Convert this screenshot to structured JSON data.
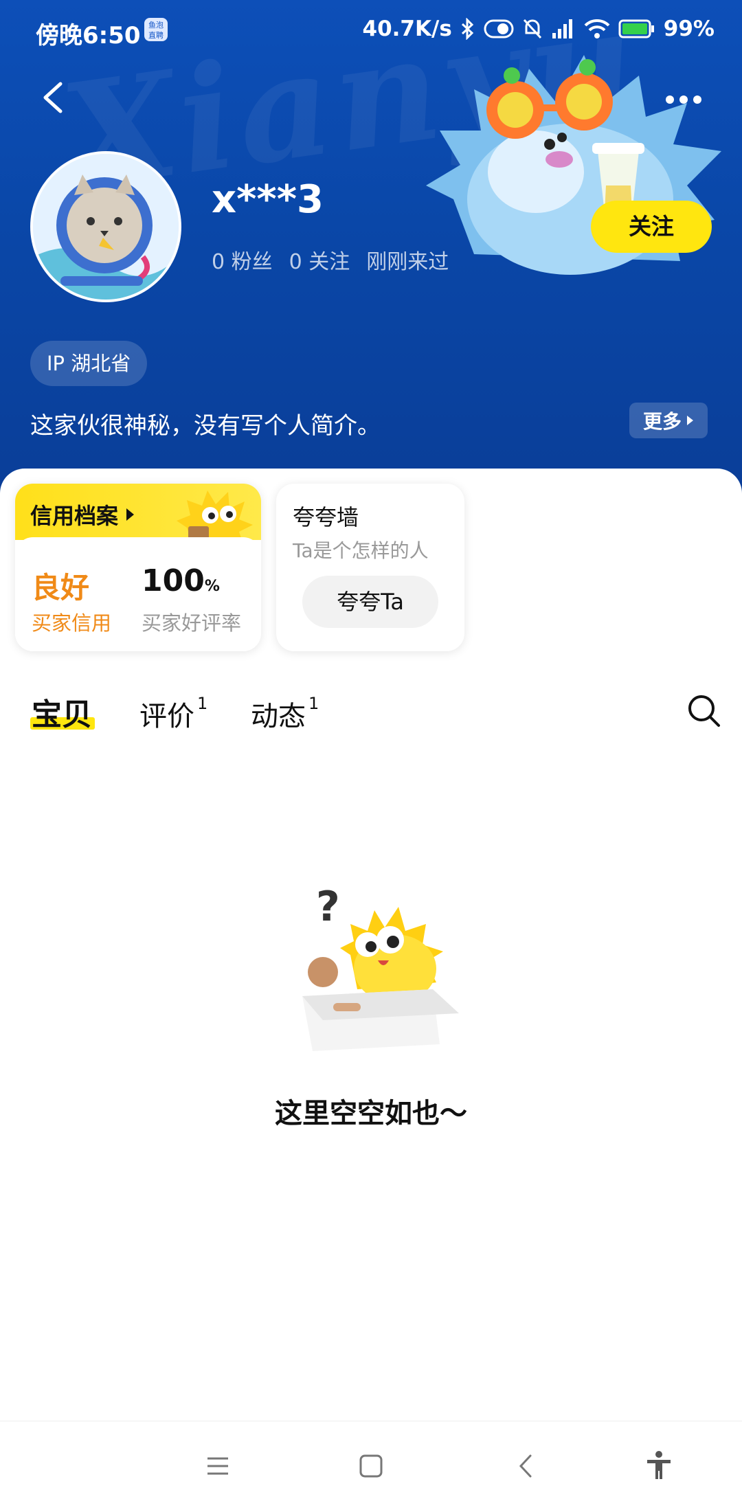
{
  "status_bar": {
    "time": "傍晚6:50",
    "app_badge": "鱼泡\n直聘",
    "network_speed": "40.7K/s",
    "battery": "99%"
  },
  "header": {
    "bg_word": "Xianyu",
    "username": "x***3",
    "stats": {
      "fans": "0 粉丝",
      "following": "0 关注",
      "last_seen": "刚刚来过"
    },
    "follow_label": "关注",
    "ip_label": "IP 湖北省",
    "bio": "这家伙很神秘，没有写个人简介。",
    "more_label": "更多"
  },
  "credit": {
    "title": "信用档案",
    "rating_value": "良好",
    "rating_label": "买家信用",
    "praise_value": "100",
    "praise_unit": "%",
    "praise_label": "买家好评率"
  },
  "praise_wall": {
    "title": "夸夸墙",
    "subtitle": "Ta是个怎样的人",
    "button": "夸夸Ta"
  },
  "tabs": [
    {
      "label": "宝贝",
      "count": ""
    },
    {
      "label": "评价",
      "count": "1"
    },
    {
      "label": "动态",
      "count": "1"
    }
  ],
  "empty": {
    "text": "这里空空如也～"
  },
  "colors": {
    "header_blue": "#0d4fb8",
    "accent_yellow": "#ffe60f",
    "credit_orange": "#f08a17"
  }
}
